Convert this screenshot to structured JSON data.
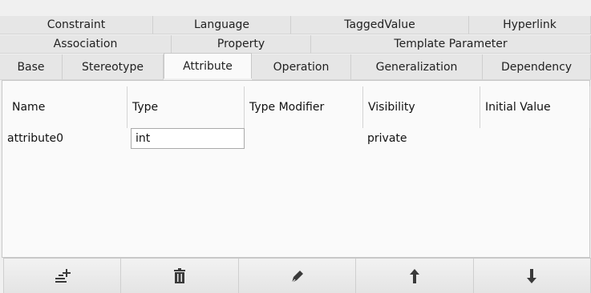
{
  "tabs": {
    "row1": [
      "Constraint",
      "Language",
      "TaggedValue",
      "Hyperlink"
    ],
    "row2": [
      "Association",
      "Property",
      "Template Parameter"
    ],
    "row3": [
      "Base",
      "Stereotype",
      "Attribute",
      "Operation",
      "Generalization",
      "Dependency"
    ],
    "active": "Attribute"
  },
  "table": {
    "columns": [
      "Name",
      "Type",
      "Type Modifier",
      "Visibility",
      "Initial Value"
    ],
    "rows": [
      {
        "name": "attribute0",
        "type": "int",
        "type_modifier": "",
        "visibility": "private",
        "initial_value": ""
      }
    ]
  },
  "toolbar": {
    "buttons": [
      "add-attribute-icon",
      "delete-icon",
      "edit-icon",
      "move-up-icon",
      "move-down-icon"
    ],
    "icon_color": "#3a3a3a"
  }
}
